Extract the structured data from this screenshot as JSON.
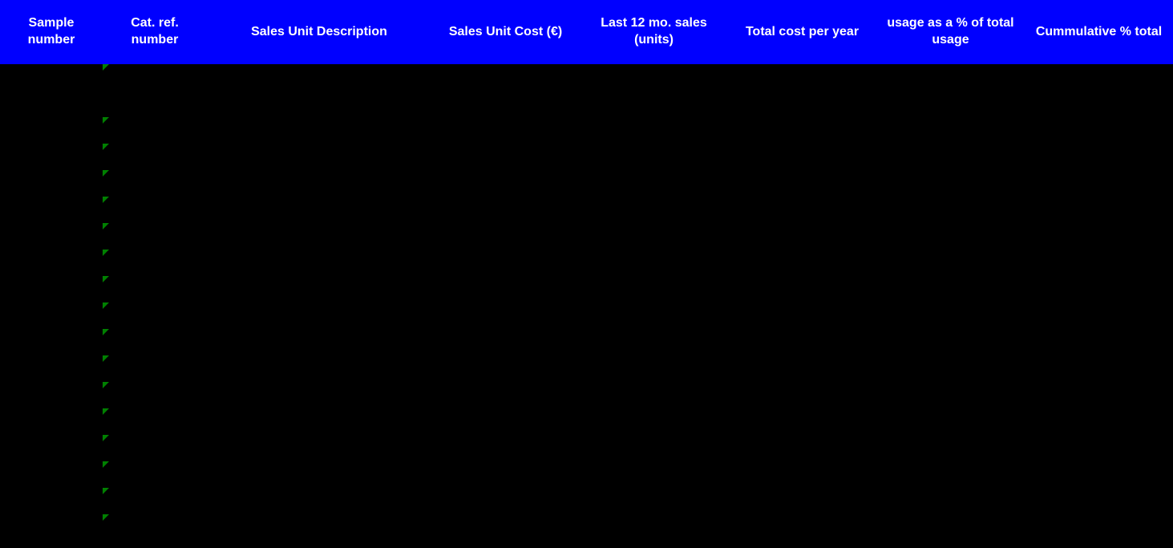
{
  "table": {
    "headers": [
      "Sample number",
      "Cat. ref. number",
      "Sales Unit Description",
      "Sales Unit Cost (€)",
      "Last 12 mo. sales (units)",
      "Total cost per year",
      "usage as a % of total usage",
      "Cummulative % total"
    ],
    "rowCount": 18,
    "markerRows": [
      0,
      2,
      3,
      4,
      5,
      6,
      7,
      8,
      9,
      10,
      11,
      12,
      13,
      14,
      15,
      16,
      17,
      18
    ]
  }
}
